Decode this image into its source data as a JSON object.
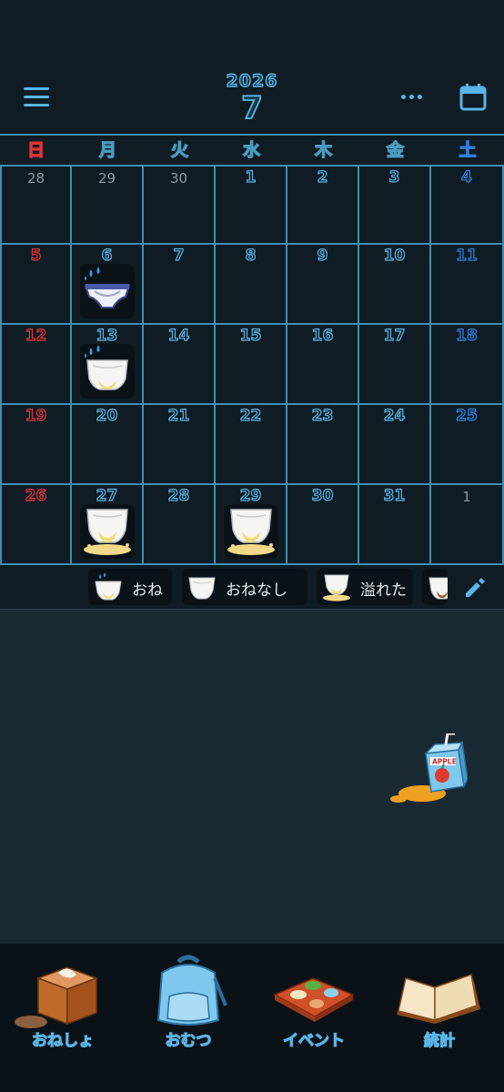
{
  "header": {
    "year": "2026",
    "month": "7",
    "menu_icon": "hamburger-menu-icon",
    "more_icon": "more-horizontal-icon",
    "calendar_icon": "calendar-icon"
  },
  "weekdays": [
    "日",
    "月",
    "火",
    "水",
    "木",
    "金",
    "土"
  ],
  "weeks": [
    [
      "28",
      "29",
      "30",
      "1",
      "2",
      "3",
      "4"
    ],
    [
      "5",
      "6",
      "7",
      "8",
      "9",
      "10",
      "11"
    ],
    [
      "12",
      "13",
      "14",
      "15",
      "16",
      "17",
      "18"
    ],
    [
      "19",
      "20",
      "21",
      "22",
      "23",
      "24",
      "25"
    ],
    [
      "26",
      "27",
      "28",
      "29",
      "30",
      "31",
      "1"
    ]
  ],
  "stamps": [
    {
      "date": "6",
      "icon": "wet-briefs-icon"
    },
    {
      "date": "13",
      "icon": "wet-diaper-icon"
    },
    {
      "date": "27",
      "icon": "overflow-diaper-icon"
    },
    {
      "date": "29",
      "icon": "overflow-diaper-icon"
    }
  ],
  "legend": [
    {
      "label": "おね",
      "icon": "wet-diaper-icon"
    },
    {
      "label": "おねなし",
      "icon": "dry-diaper-icon"
    },
    {
      "label": "溢れた",
      "icon": "overflow-diaper-icon"
    }
  ],
  "edit_icon": "pencil-icon",
  "decor_icon": "spilled-apple-juice-icon",
  "juice_box_text": "APPLE",
  "tabs": [
    {
      "label": "おねしょ",
      "icon": "spilled-box-icon"
    },
    {
      "label": "おむつ",
      "icon": "backpack-icon"
    },
    {
      "label": "イベント",
      "icon": "lunch-tray-icon"
    },
    {
      "label": "統計",
      "icon": "open-book-icon"
    }
  ],
  "colors": {
    "background": "#1a2a33",
    "header_bg": "#0f1c23",
    "accent": "#5ab4e6",
    "grid_line": "#3d8fb0",
    "sunday": "#e0333a",
    "saturday": "#2f7fe0"
  }
}
